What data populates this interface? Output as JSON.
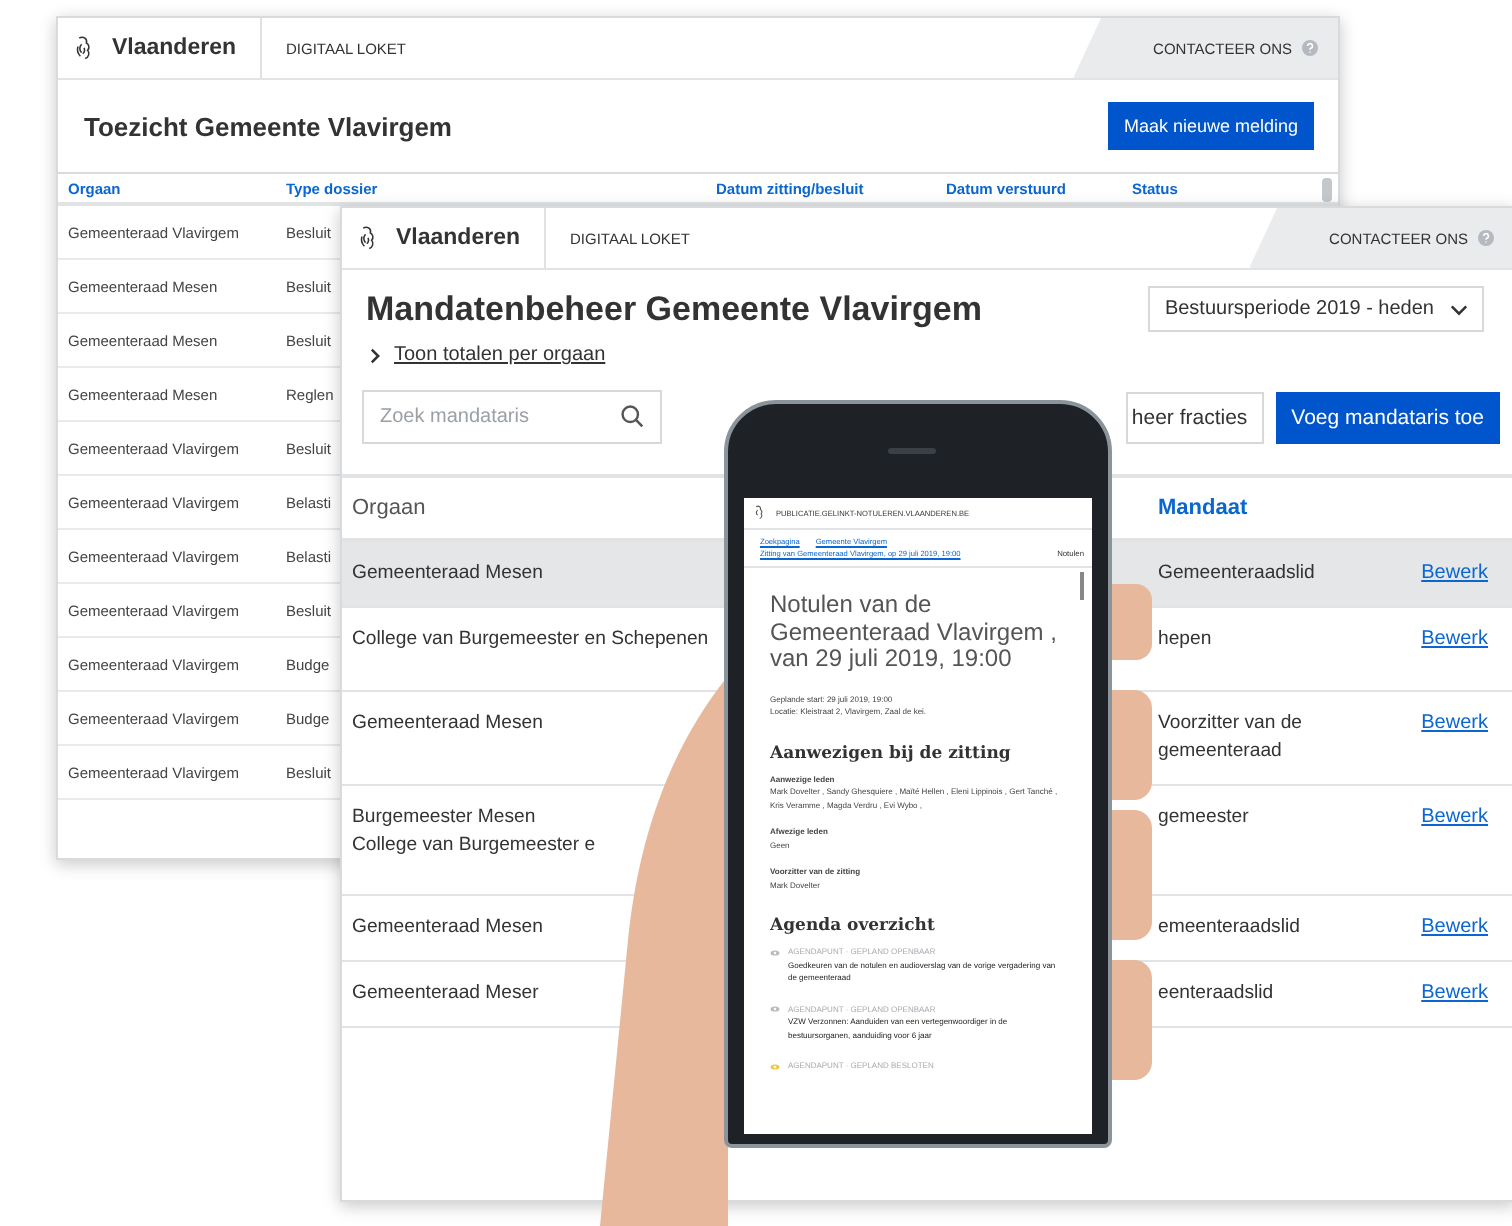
{
  "back_window": {
    "header": {
      "brand": "Vlaanderen",
      "app": "DIGITAAL LOKET",
      "contact": "CONTACTEER ONS"
    },
    "title": "Toezicht Gemeente Vlavirgem",
    "button": "Maak nieuwe melding",
    "table": {
      "columns": [
        "Orgaan",
        "Type dossier",
        "Datum zitting/besluit",
        "Datum verstuurd",
        "Status"
      ],
      "rows": [
        [
          "Gemeenteraad Vlavirgem",
          "Besluit"
        ],
        [
          "Gemeenteraad Mesen",
          "Besluit"
        ],
        [
          "Gemeenteraad Mesen",
          "Besluit"
        ],
        [
          "Gemeenteraad Mesen",
          "Reglen"
        ],
        [
          "Gemeenteraad Vlavirgem",
          "Besluit"
        ],
        [
          "Gemeenteraad Vlavirgem",
          "Belasti"
        ],
        [
          "Gemeenteraad Vlavirgem",
          "Belasti"
        ],
        [
          "Gemeenteraad Vlavirgem",
          "Besluit"
        ],
        [
          "Gemeenteraad Vlavirgem",
          "Budge"
        ],
        [
          "Gemeenteraad Vlavirgem",
          "Budge"
        ],
        [
          "Gemeenteraad Vlavirgem",
          "Besluit"
        ]
      ]
    }
  },
  "front_window": {
    "header": {
      "brand": "Vlaanderen",
      "app": "DIGITAAL LOKET",
      "contact": "CONTACTEER ONS"
    },
    "title": "Mandatenbeheer Gemeente Vlavirgem",
    "period_select": "Bestuursperiode 2019 - heden",
    "toggle_link": "Toon totalen per orgaan",
    "search": {
      "placeholder": "Zoek mandataris"
    },
    "buttons": [
      {
        "label": "heer fracties",
        "kind": "secondary"
      },
      {
        "label": "Voeg mandataris toe",
        "kind": "primary"
      }
    ],
    "table": {
      "columns": [
        "Orgaan",
        "Mandaat"
      ],
      "rows": [
        {
          "orgaan": [
            "Gemeenteraad Mesen"
          ],
          "mandaat": "Gemeenteraadslid",
          "action": "Bewerk",
          "selected": true
        },
        {
          "orgaan": [
            "College van Burgemeester en Schepenen"
          ],
          "mandaat": "hepen",
          "action": "Bewerk",
          "selected": false
        },
        {
          "orgaan": [
            "Gemeenteraad Mesen"
          ],
          "mandaat": "Voorzitter van de gemeenteraad",
          "action": "Bewerk",
          "selected": false
        },
        {
          "orgaan": [
            "Burgemeester Mesen",
            "College van Burgemeester e"
          ],
          "mandaat": "gemeester",
          "action": "Bewerk",
          "selected": false
        },
        {
          "orgaan": [
            "Gemeenteraad Mesen"
          ],
          "mandaat": "emeenteraadslid",
          "action": "Bewerk",
          "selected": false
        },
        {
          "orgaan": [
            "Gemeenteraad Meser"
          ],
          "mandaat": "eenteraadslid",
          "action": "Bewerk",
          "selected": false
        }
      ]
    }
  },
  "phone": {
    "domain": "PUBLICATIE.GELINKT-NOTULEREN.VLAANDEREN.BE",
    "breadcrumb": [
      "Zoekpagina",
      "Gemeente Vlavirgem",
      "Zitting van Gemeenteraad Vlavirgem, op 29 juli 2019, 19:00"
    ],
    "current": "Notulen",
    "title": "Notulen van de Gemeenteraad Vlavirgem , van 29 juli 2019, 19:00",
    "meta": [
      "Geplande start: 29 juli 2019, 19:00",
      "Locatie: Kleistraat 2, Vlavirgem, Zaal de kei."
    ],
    "attendance": {
      "heading": "Aanwezigen bij de zitting",
      "groups": [
        {
          "label": "Aanwezige leden",
          "value": "Mark Dovelter , Sandy Ghesquiere , Maïté Hellen , Eleni Lippinois , Gert Tanché , Kris Veramme , Magda Verdru , Evi Wybo ,"
        },
        {
          "label": "Afwezige leden",
          "value": "Geen"
        },
        {
          "label": "Voorzitter van de zitting",
          "value": "Mark Dovelter"
        }
      ]
    },
    "agenda": {
      "heading": "Agenda overzicht",
      "items": [
        {
          "kind": "public",
          "label": "AGENDAPUNT · GEPLAND OPENBAAR",
          "text": "Goedkeuren van de notulen en audioverslag van de vorige vergadering van de gemeenteraad"
        },
        {
          "kind": "public",
          "label": "AGENDAPUNT · GEPLAND OPENBAAR",
          "text": "VZW Verzonnen: Aanduiden van een vertegenwoordiger in de bestuursorganen, aanduiding voor 6 jaar"
        },
        {
          "kind": "closed",
          "label": "AGENDAPUNT · GEPLAND BESLOTEN"
        }
      ]
    }
  }
}
